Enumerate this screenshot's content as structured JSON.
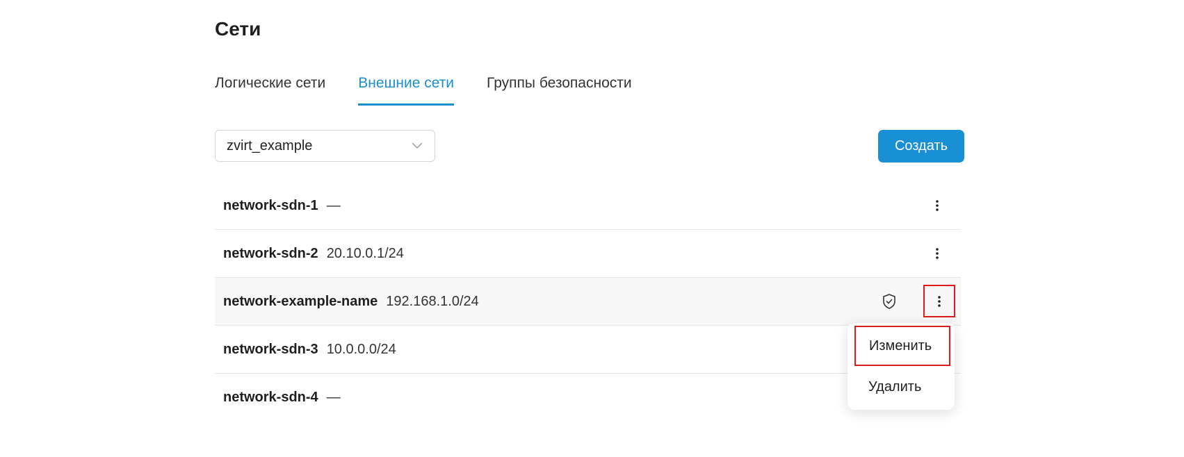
{
  "page": {
    "title": "Сети"
  },
  "tabs": [
    {
      "label": "Логические сети",
      "active": false
    },
    {
      "label": "Внешние сети",
      "active": true
    },
    {
      "label": "Группы безопасности",
      "active": false
    }
  ],
  "filter": {
    "selected": "zvirt_example",
    "icon": "chevron-down-icon"
  },
  "actions": {
    "create_label": "Создать"
  },
  "networks": [
    {
      "name": "network-sdn-1",
      "cidr": "—"
    },
    {
      "name": "network-sdn-2",
      "cidr": "20.10.0.1/24"
    },
    {
      "name": "network-example-name",
      "cidr": "192.168.1.0/24"
    },
    {
      "name": "network-sdn-3",
      "cidr": "10.0.0.0/24"
    },
    {
      "name": "network-sdn-4",
      "cidr": "—"
    }
  ],
  "context_menu": {
    "items": [
      {
        "label": "Изменить"
      },
      {
        "label": "Удалить"
      }
    ]
  },
  "colors": {
    "accent": "#1a8fd0",
    "button": "#1990d6",
    "highlight_outline": "#e01a1a",
    "row_highlight": "#f7f7f7"
  }
}
